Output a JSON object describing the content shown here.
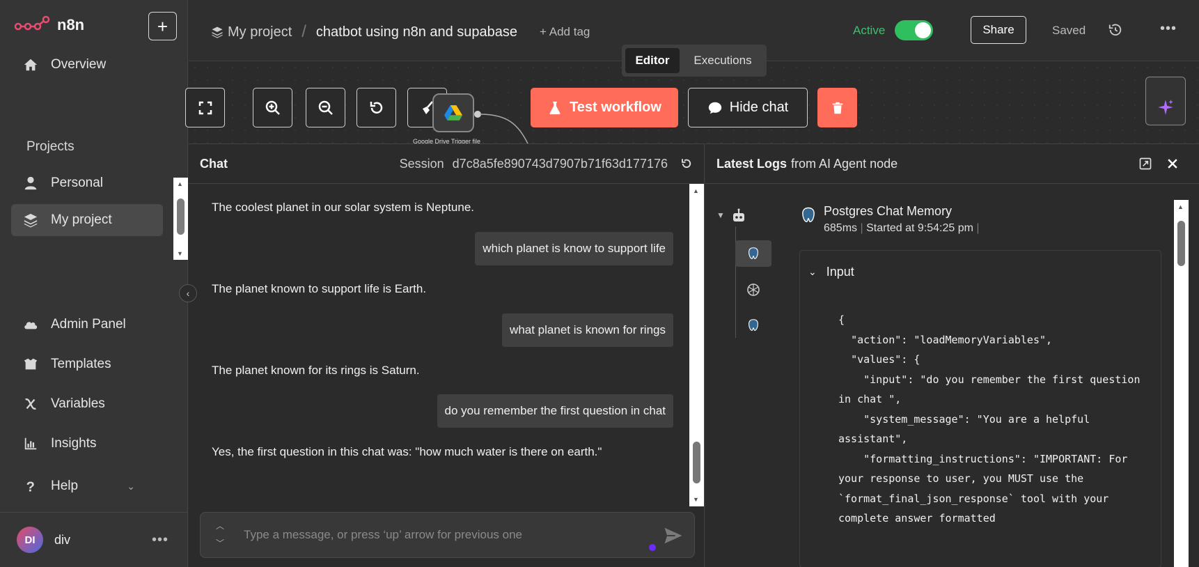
{
  "brand": {
    "name": "n8n"
  },
  "sidebar": {
    "overview": "Overview",
    "projects_label": "Projects",
    "personal": "Personal",
    "my_project": "My project",
    "admin_panel": "Admin Panel",
    "templates": "Templates",
    "variables": "Variables",
    "insights": "Insights",
    "help": "Help",
    "user": {
      "initials": "DI",
      "name": "div"
    }
  },
  "header": {
    "project": "My project",
    "workflow_name": "chatbot using n8n and supabase",
    "add_tag": "+ Add tag",
    "active_label": "Active",
    "active": true,
    "share": "Share",
    "saved": "Saved"
  },
  "tabs": {
    "editor": "Editor",
    "executions": "Executions"
  },
  "canvas": {
    "node_label": "Google Drive Trigger file",
    "test_workflow": "Test workflow",
    "hide_chat": "Hide chat"
  },
  "chat": {
    "title": "Chat",
    "session_label": "Session",
    "session_id": "d7c8a5fe890743d7907b71f63d177176",
    "messages": [
      {
        "role": "bot",
        "text": "The coolest planet in our solar system is Neptune."
      },
      {
        "role": "user",
        "text": "which planet is know to support life"
      },
      {
        "role": "bot",
        "text": "The planet known to support life is Earth."
      },
      {
        "role": "user",
        "text": "what planet is known for rings"
      },
      {
        "role": "bot",
        "text": "The planet known for its rings is Saturn."
      },
      {
        "role": "user",
        "text": "do you remember the first question in chat"
      },
      {
        "role": "bot",
        "text": "Yes, the first question in this chat was: \"how much water is there on earth.\""
      }
    ],
    "input_placeholder": "Type a message, or press ‘up’ arrow for previous one"
  },
  "logs": {
    "title_strong": "Latest Logs",
    "title_rest": "from AI Agent node",
    "node_name": "Postgres Chat Memory",
    "duration": "685ms",
    "started": "Started at 9:54:25 pm",
    "input_label": "Input",
    "json_text": "{\n  \"action\": \"loadMemoryVariables\",\n  \"values\": {\n    \"input\": \"do you remember the first question in chat \",\n    \"system_message\": \"You are a helpful assistant\",\n    \"formatting_instructions\": \"IMPORTANT: For your response to user, you MUST use the `format_final_json_response` tool with your complete answer formatted"
  },
  "colors": {
    "accent": "#ff6d5a",
    "active_green": "#2fbf5f",
    "sidebar_bg": "#353535",
    "panel_bg": "#2b2b2b"
  }
}
